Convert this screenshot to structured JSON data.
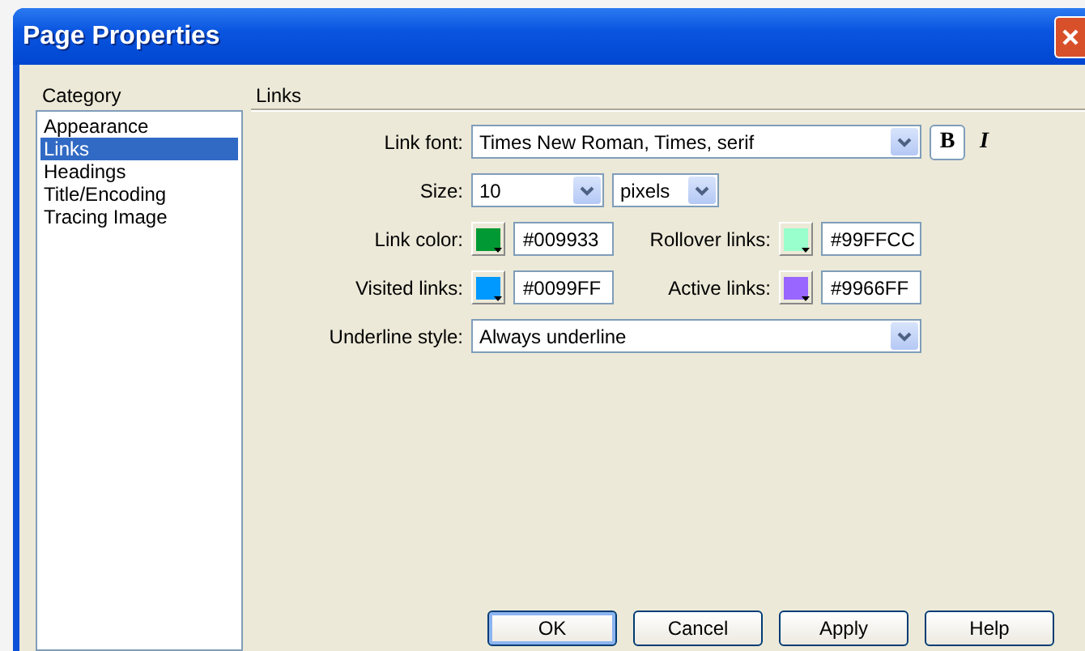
{
  "window": {
    "title": "Page Properties"
  },
  "category": {
    "label": "Category",
    "items": [
      {
        "label": "Appearance",
        "selected": false
      },
      {
        "label": "Links",
        "selected": true
      },
      {
        "label": "Headings",
        "selected": false
      },
      {
        "label": "Title/Encoding",
        "selected": false
      },
      {
        "label": "Tracing Image",
        "selected": false
      }
    ]
  },
  "panel": {
    "title": "Links",
    "link_font": {
      "label": "Link font:",
      "value": "Times New Roman, Times, serif"
    },
    "bold_button": "B",
    "italic_button": "I",
    "size": {
      "label": "Size:",
      "value": "10",
      "unit": "pixels"
    },
    "colors": [
      {
        "label": "Link color:",
        "color": "#009933",
        "value": "#009933"
      },
      {
        "label": "Rollover links:",
        "color": "#99ffcc",
        "value": "#99FFCC"
      },
      {
        "label": "Visited links:",
        "color": "#0099ff",
        "value": "#0099FF"
      },
      {
        "label": "Active links:",
        "color": "#9966ff",
        "value": "#9966FF"
      }
    ],
    "underline_style": {
      "label": "Underline style:",
      "value": "Always underline"
    }
  },
  "buttons": [
    {
      "label": "OK",
      "default": true
    },
    {
      "label": "Cancel",
      "default": false
    },
    {
      "label": "Apply",
      "default": false
    },
    {
      "label": "Help",
      "default": false
    }
  ]
}
